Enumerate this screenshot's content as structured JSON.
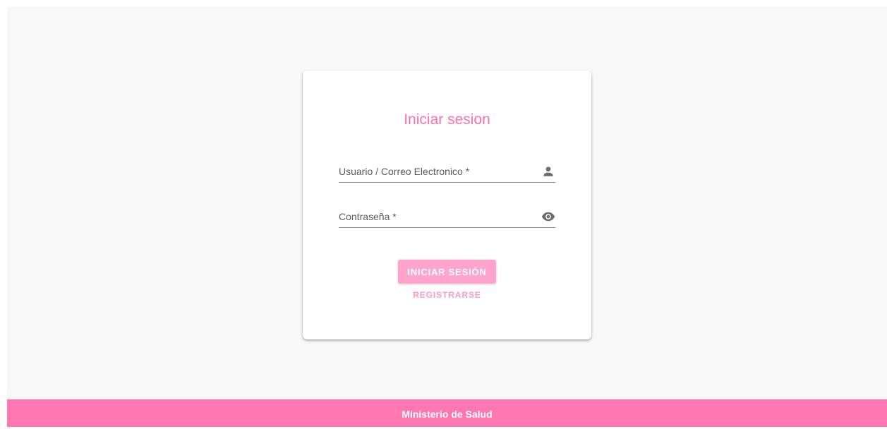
{
  "login": {
    "title": "Iniciar sesion",
    "username": {
      "placeholder": "Usuario / Correo Electronico *",
      "value": "",
      "icon": "person-icon"
    },
    "password": {
      "placeholder": "Contraseña *",
      "value": "",
      "icon": "eye-icon"
    },
    "submit_label": "INICIAR SESIÓN",
    "register_label": "REGISTRARSE"
  },
  "footer": {
    "text": "Ministerio de Salud"
  },
  "colors": {
    "accent": "#ff6fa8",
    "button": "#ffa4cc",
    "footer": "#ff77b1",
    "background": "#f8f8f8",
    "icon": "#6b6b6b"
  }
}
